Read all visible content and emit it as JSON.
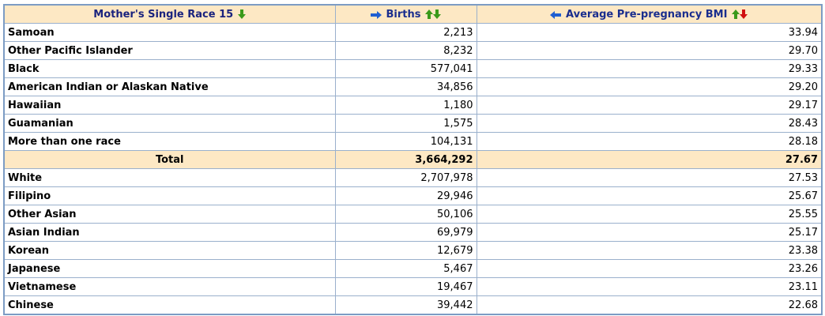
{
  "columns": {
    "race": "Mother's Single Race 15",
    "births": "Births",
    "bmi": "Average Pre-pregnancy BMI"
  },
  "colors": {
    "header_bg": "#fde8c4",
    "border": "#7c9cc4",
    "arrow_blue": "#1f5fd1",
    "arrow_green": "#3a9a1a",
    "arrow_red": "#d01010"
  },
  "rows": [
    {
      "race": "Samoan",
      "births": "2,213",
      "bmi": "33.94"
    },
    {
      "race": "Other Pacific Islander",
      "births": "8,232",
      "bmi": "29.70"
    },
    {
      "race": "Black",
      "births": "577,041",
      "bmi": "29.33"
    },
    {
      "race": "American Indian or Alaskan Native",
      "births": "34,856",
      "bmi": "29.20"
    },
    {
      "race": "Hawaiian",
      "births": "1,180",
      "bmi": "29.17"
    },
    {
      "race": "Guamanian",
      "births": "1,575",
      "bmi": "28.43"
    },
    {
      "race": "More than one race",
      "births": "104,131",
      "bmi": "28.18"
    },
    {
      "race": "Total",
      "births": "3,664,292",
      "bmi": "27.67"
    },
    {
      "race": "White",
      "births": "2,707,978",
      "bmi": "27.53"
    },
    {
      "race": "Filipino",
      "births": "29,946",
      "bmi": "25.67"
    },
    {
      "race": "Other Asian",
      "births": "50,106",
      "bmi": "25.55"
    },
    {
      "race": "Asian Indian",
      "births": "69,979",
      "bmi": "25.17"
    },
    {
      "race": "Korean",
      "births": "12,679",
      "bmi": "23.38"
    },
    {
      "race": "Japanese",
      "births": "5,467",
      "bmi": "23.26"
    },
    {
      "race": "Vietnamese",
      "births": "19,467",
      "bmi": "23.11"
    },
    {
      "race": "Chinese",
      "births": "39,442",
      "bmi": "22.68"
    }
  ]
}
